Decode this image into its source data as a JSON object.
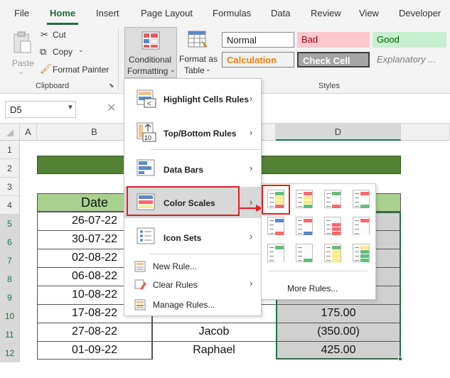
{
  "menu": {
    "tabs": [
      "File",
      "Home",
      "Insert",
      "Page Layout",
      "Formulas",
      "Data",
      "Review",
      "View",
      "Developer"
    ]
  },
  "ribbon": {
    "clipboard": {
      "paste": "Paste",
      "cut": "Cut",
      "copy": "Copy",
      "format_painter": "Format Painter",
      "label": "Clipboard"
    },
    "styles_group": {
      "conditional_formatting_line1": "Conditional",
      "conditional_formatting_line2": "Formatting",
      "format_as_table_line1": "Format as",
      "format_as_table_line2": "Table",
      "label": "Styles",
      "styles": {
        "normal": "Normal",
        "bad": "Bad",
        "good": "Good",
        "calculation": "Calculation",
        "check_cell": "Check Cell",
        "explanatory": "Explanatory ..."
      }
    }
  },
  "formula_bar": {
    "name_box": "D5"
  },
  "columns": [
    "A",
    "B",
    "D"
  ],
  "rows": [
    "1",
    "2",
    "3",
    "4",
    "5",
    "6",
    "7",
    "8",
    "9",
    "10",
    "11",
    "12"
  ],
  "table": {
    "header_date": "Date",
    "dates": [
      "26-07-22",
      "30-07-22",
      "02-08-22",
      "06-08-22",
      "10-08-22",
      "17-08-22",
      "27-08-22",
      "01-09-22"
    ],
    "names_visible": [
      "Jacob",
      "Raphael"
    ],
    "amounts_visible": [
      "175.00",
      "(350.00)",
      "425.00"
    ]
  },
  "cf_menu": {
    "items": [
      {
        "label": "Highlight Cells Rules",
        "underline": "H"
      },
      {
        "label": "Top/Bottom Rules",
        "underline": "T"
      },
      {
        "label": "Data Bars",
        "underline": "D"
      },
      {
        "label": "Color Scales",
        "underline": "S"
      },
      {
        "label": "Icon Sets",
        "underline": "I"
      },
      {
        "label": "New Rule...",
        "underline": "N"
      },
      {
        "label": "Clear Rules",
        "underline": "C"
      },
      {
        "label": "Manage Rules...",
        "underline": "R"
      }
    ]
  },
  "color_scales": {
    "more_rules": "More Rules...",
    "swatches": [
      [
        "#63be7b",
        "#ffeb84",
        "#f8696b"
      ],
      [
        "#f8696b",
        "#ffeb84",
        "#63be7b"
      ],
      [
        "#63be7b",
        "#fcfcff",
        "#f8696b"
      ],
      [
        "#f8696b",
        "#fcfcff",
        "#63be7b"
      ],
      [
        "#5a8ac6",
        "#fcfcff",
        "#f8696b"
      ],
      [
        "#f8696b",
        "#fcfcff",
        "#5a8ac6"
      ],
      [
        "#fcfcff",
        "#f8696b",
        "#f8696b"
      ],
      [
        "#f8696b",
        "#fcfcff",
        "#fcfcff"
      ],
      [
        "#63be7b",
        "#fcfcff",
        "#fcfcff"
      ],
      [
        "#fcfcff",
        "#fcfcff",
        "#63be7b"
      ],
      [
        "#63be7b",
        "#ffeb84",
        "#ffeb84"
      ],
      [
        "#ffeb84",
        "#63be7b",
        "#63be7b"
      ]
    ]
  },
  "colors": {
    "title_bar_green": "#548235",
    "header_green": "#a9d18e",
    "selection_gray": "#d0d0d0",
    "highlight_red": "#e02020"
  }
}
